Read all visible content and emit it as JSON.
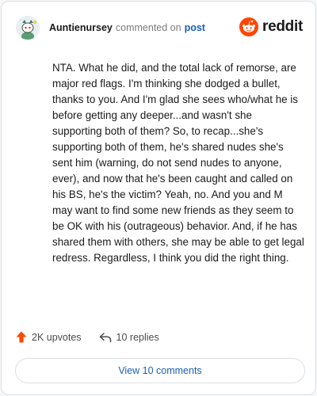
{
  "header": {
    "username": "Auntienursey",
    "action_text": "commented on",
    "target": "post",
    "brand": "reddit"
  },
  "comment": {
    "text": "NTA. What he did, and the total lack of remorse, are major red flags. I'm thinking she dodged a bullet, thanks to you. And I'm glad she sees who/what he is before getting any deeper...and wasn't she supporting both of them? So, to recap...she's supporting both of them, he's shared nudes she's sent him (warning, do not send nudes to anyone, ever), and now that he's been caught and called on his BS, he's the victim? Yeah, no. And you and M may want to find some new friends as they seem to be OK with his (outrageous) behavior. And, if he has shared them with others, she may be able to get legal redress. Regardless, I think you did the right thing."
  },
  "actions": {
    "upvotes": "2K upvotes",
    "replies": "10 replies"
  },
  "footer": {
    "view_comments": "View 10 comments"
  },
  "colors": {
    "reddit_orange": "#ff4500",
    "link_blue": "#1a5fb4"
  },
  "icons": {
    "avatar": "snoo-avatar-icon",
    "brand": "reddit-logo-icon",
    "upvote": "upvote-arrow-icon",
    "reply": "reply-arrow-icon"
  }
}
